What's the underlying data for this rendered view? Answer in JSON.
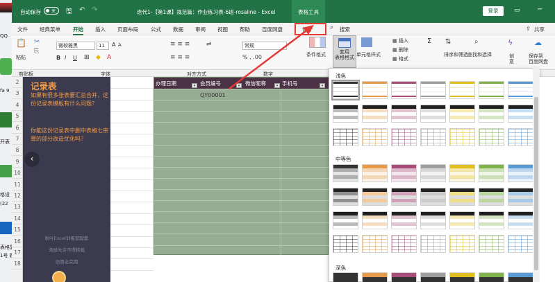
{
  "titlebar": {
    "autosave": "自动保存",
    "autosave_toggle": "关",
    "title": "迭代1-【第1课】规范篇：作业练习表-6班-rosaline - Excel",
    "table_tools": "表格工具",
    "login": "登录",
    "undo": "↶",
    "redo": "↷"
  },
  "menus": [
    "文件",
    "经典菜单",
    "开始",
    "插入",
    "页面布局",
    "公式",
    "数据",
    "审阅",
    "视图",
    "帮助",
    "百度网盘",
    "设计",
    "搜索",
    "共享"
  ],
  "ribbon": {
    "paste": "粘贴",
    "font_name": "微软雅黑",
    "font_size": "11",
    "format": "常规",
    "cond_format": "条件格式",
    "table_format": "套用\n表格格式",
    "cell_style": "单元格样式",
    "insert": "插入",
    "delete": "删除",
    "format_btn": "格式",
    "sort_filter": "排序和筛选",
    "find_select": "查找和选择",
    "create": "创\n意",
    "save_to_pan": "保存到\n百度网盘",
    "font_b": "B",
    "font_i": "I",
    "font_u": "U",
    "font_A1": "A",
    "font_A2": "A"
  },
  "groups": [
    "剪贴板",
    "字体",
    "对齐方式",
    "数字"
  ],
  "rows": [
    "2",
    "3",
    "4",
    "5",
    "6",
    "7",
    "8",
    "9",
    "10",
    "11",
    "12",
    "13",
    "14",
    "15",
    "16",
    "17",
    "18"
  ],
  "panel": {
    "title": "记录表",
    "q1": "如果有很多张表要汇总合并，这份记录表模板有什么问题？",
    "q2": "你能这份记录表中删中表格七宗罪的部分改造优化吗？",
    "f1": "秋叶Excel训练营配套",
    "f2": "未经允许不得转载",
    "f3": "仿冒必究用"
  },
  "table": {
    "headers": [
      "办理日期",
      "会员编号",
      "微信昵称",
      "手机号"
    ],
    "cell1": "QY00001"
  },
  "gallery": {
    "light": "浅色",
    "medium": "中等色",
    "dark": "深色"
  },
  "desktop": {
    "l1": "QQ",
    "l2": "fa 9",
    "l3": "开表",
    "l4": "格设",
    "l5": "(22",
    "l6": "表格复",
    "l7": "1号 题"
  },
  "colors": {
    "excel_green": "#217346",
    "highlight": "#e53935",
    "panel_bg": "#3b3a4f",
    "header_bg": "#4a3144"
  },
  "icons": [
    "save-icon",
    "undo-icon",
    "redo-icon",
    "search-icon",
    "share-icon",
    "chevron-left-icon"
  ]
}
